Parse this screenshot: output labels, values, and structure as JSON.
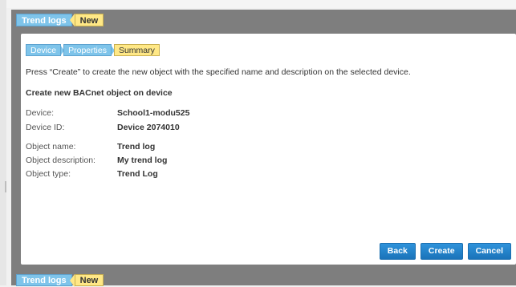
{
  "header": {
    "breadcrumb": [
      "Trend logs",
      "New"
    ]
  },
  "wizard": {
    "steps": [
      "Device",
      "Properties",
      "Summary"
    ],
    "current_step": "Summary",
    "instruction": "Press “Create” to create the new object with the specified name and description on the selected device.",
    "section_title": "Create new BACnet object on device",
    "fields": {
      "device_label": "Device:",
      "device_value": "School1-modu525",
      "device_id_label": "Device ID:",
      "device_id_value": "Device 2074010",
      "object_name_label": "Object name:",
      "object_name_value": "Trend log",
      "object_description_label": "Object description:",
      "object_description_value": "My trend log",
      "object_type_label": "Object type:",
      "object_type_value": "Trend Log"
    },
    "buttons": {
      "back": "Back",
      "create": "Create",
      "cancel": "Cancel"
    }
  },
  "footer": {
    "breadcrumb": [
      "Trend logs",
      "New"
    ]
  },
  "colors": {
    "accent_blue": "#7ec4ea",
    "current_yellow": "#ffe886",
    "button_blue": "#1a73b9",
    "frame_gray": "#7e7e7e"
  }
}
